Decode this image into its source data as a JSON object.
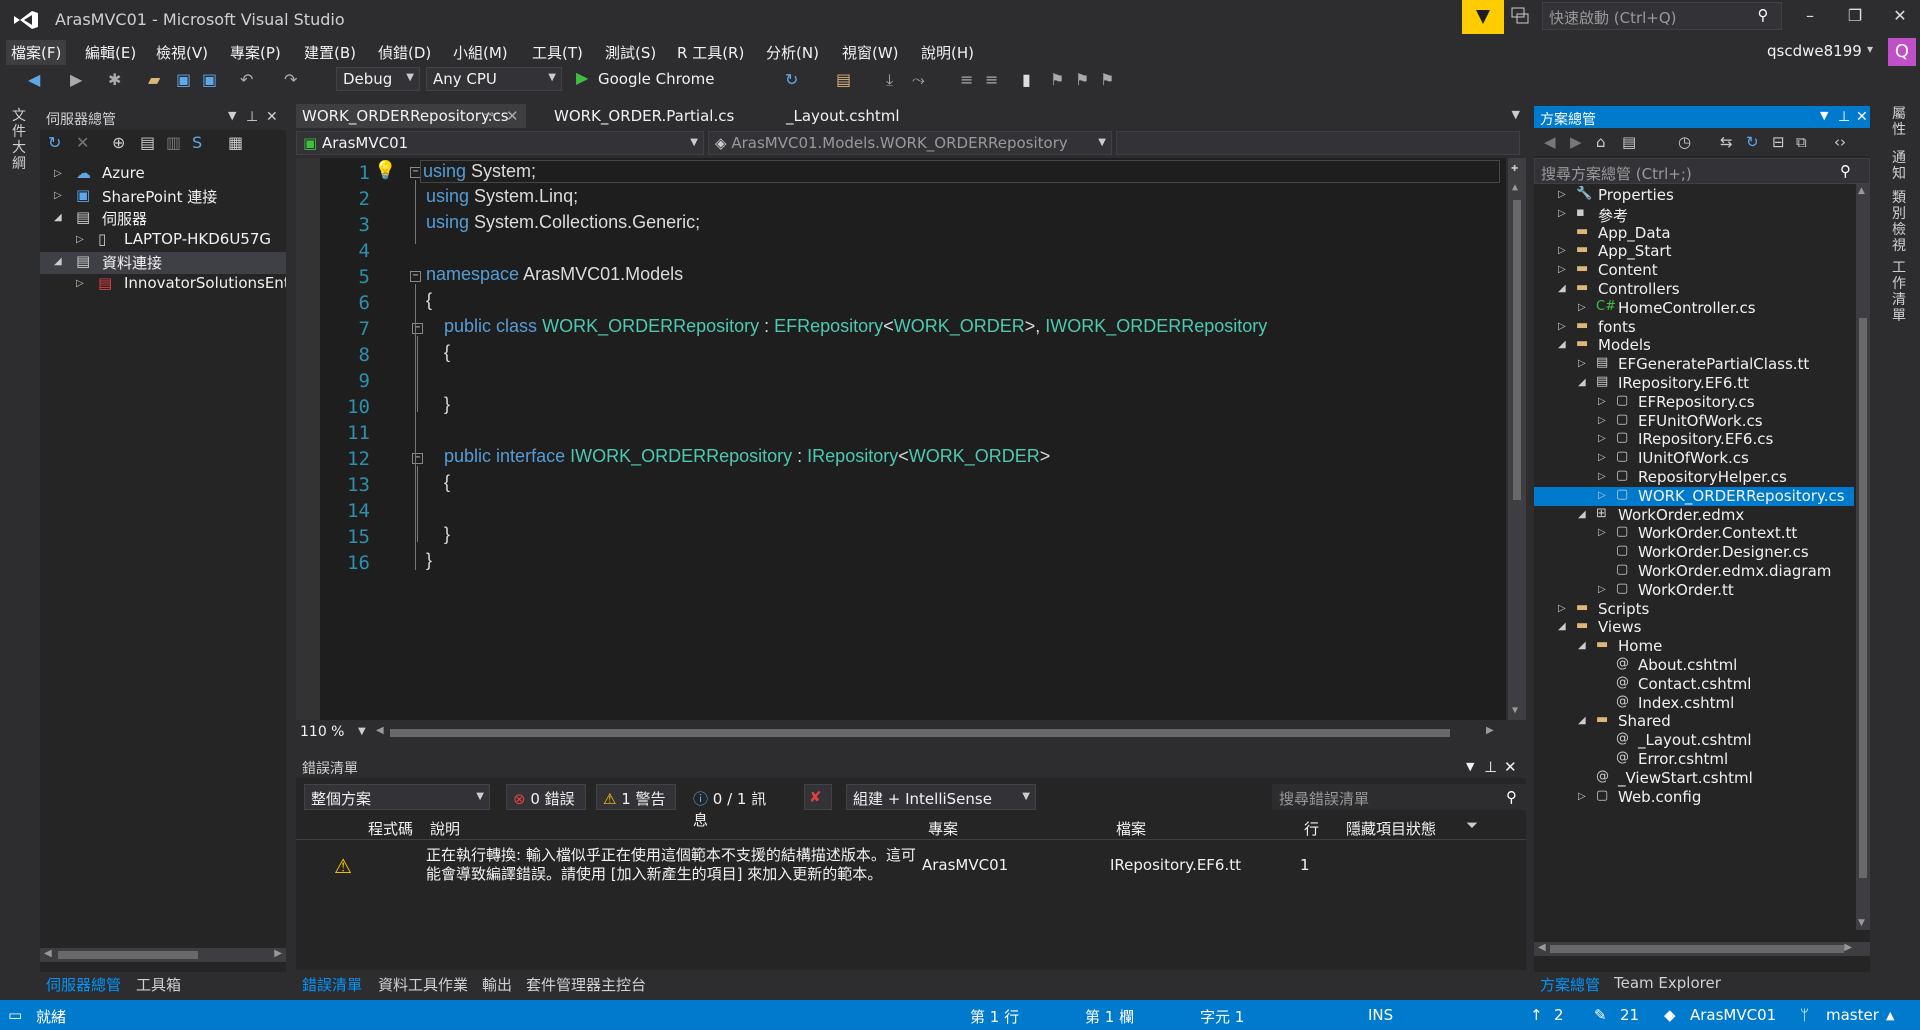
{
  "window": {
    "title": "ArasMVC01 - Microsoft Visual Studio",
    "quick_launch_placeholder": "快速啟動 (Ctrl+Q)",
    "user": "qscdwe8199",
    "avatar_letter": "Q"
  },
  "menu": [
    "檔案(F)",
    "編輯(E)",
    "檢視(V)",
    "專案(P)",
    "建置(B)",
    "偵錯(D)",
    "小組(M)",
    "工具(T)",
    "測試(S)",
    "R 工具(R)",
    "分析(N)",
    "視窗(W)",
    "說明(H)"
  ],
  "toolbar": {
    "config": "Debug",
    "platform": "Any CPU",
    "run_target": "Google Chrome"
  },
  "left_strip_label": "文件大綱",
  "server_explorer": {
    "title": "伺服器總管",
    "items": [
      {
        "label": "Azure",
        "expanded": false
      },
      {
        "label": "SharePoint 連接",
        "expanded": false
      },
      {
        "label": "伺服器",
        "expanded": true
      },
      {
        "label": "LAPTOP-HKD6U57G",
        "expanded": false
      },
      {
        "label": "資料連接",
        "expanded": true
      },
      {
        "label": "InnovatorSolutionsEntit",
        "expanded": false
      }
    ],
    "bottom_tabs": [
      "伺服器總管",
      "工具箱"
    ]
  },
  "editor": {
    "tabs": [
      "WORK_ORDERRepository.cs",
      "WORK_ORDER.Partial.cs",
      "_Layout.cshtml"
    ],
    "nav_project": "ArasMVC01",
    "nav_scope": "ArasMVC01.Models.WORK_ORDERRepository",
    "line_numbers": [
      "1",
      "2",
      "3",
      "4",
      "5",
      "6",
      "7",
      "8",
      "9",
      "10",
      "11",
      "12",
      "13",
      "14",
      "15",
      "16"
    ],
    "code": {
      "l1_kw": "using",
      "l1_rest": " System;",
      "l2_kw": "using",
      "l2_rest": " System.Linq;",
      "l3_kw": "using",
      "l3_rest": " System.Collections.Generic;",
      "l5_kw": "namespace",
      "l5_rest": " ArasMVC01.Models",
      "l6": "{",
      "l7_kw1": "public",
      "l7_kw2": "class",
      "l7_t1": "WORK_ORDERRepository",
      "l7_p1": " : ",
      "l7_t2": "EFRepository",
      "l7_p2": "<",
      "l7_t3": "WORK_ORDER",
      "l7_p3": ">, ",
      "l7_t4": "IWORK_ORDERRepository",
      "l8": "{",
      "l10": "}",
      "l12_kw1": "public",
      "l12_kw2": "interface",
      "l12_t1": "IWORK_ORDERRepository",
      "l12_p1": " : ",
      "l12_t2": "IRepository",
      "l12_p2": "<",
      "l12_t3": "WORK_ORDER",
      "l12_p3": ">",
      "l13": "{",
      "l15": "}",
      "l16": "}"
    },
    "zoom": "110 %"
  },
  "error_list": {
    "title": "錯誤清單",
    "scope": "整個方案",
    "errors": "0 錯誤",
    "warnings": "1 警告",
    "messages": "0 / 1 訊息",
    "build_filter": "組建 + IntelliSense",
    "search_placeholder": "搜尋錯誤清單",
    "columns": [
      "程式碼",
      "說明",
      "專案",
      "檔案",
      "行",
      "隱藏項目狀態"
    ],
    "row": {
      "desc_line1": "正在執行轉換: 輸入檔似乎正在使用這個範本不支援的結構描述版本。這可",
      "desc_line2": "能會導致編譯錯誤。請使用 [加入新產生的項目] 來加入更新的範本。",
      "project": "ArasMVC01",
      "file": "IRepository.EF6.tt",
      "line": "1"
    },
    "bottom_tabs": [
      "錯誤清單",
      "資料工具作業",
      "輸出",
      "套件管理器主控台"
    ]
  },
  "solution_explorer": {
    "title": "方案總管",
    "search_placeholder": "搜尋方案總管 (Ctrl+;)",
    "items": [
      "Properties",
      "參考",
      "App_Data",
      "App_Start",
      "Content",
      "Controllers",
      "HomeController.cs",
      "fonts",
      "Models",
      "EFGeneratePartialClass.tt",
      "IRepository.EF6.tt",
      "EFRepository.cs",
      "EFUnitOfWork.cs",
      "IRepository.EF6.cs",
      "IUnitOfWork.cs",
      "RepositoryHelper.cs",
      "WORK_ORDERRepository.cs",
      "WorkOrder.edmx",
      "WorkOrder.Context.tt",
      "WorkOrder.Designer.cs",
      "WorkOrder.edmx.diagram",
      "WorkOrder.tt",
      "Scripts",
      "Views",
      "Home",
      "About.cshtml",
      "Contact.cshtml",
      "Index.cshtml",
      "Shared",
      "_Layout.cshtml",
      "Error.cshtml",
      "_ViewStart.cshtml",
      "Web.config"
    ],
    "bottom_tabs": [
      "方案總管",
      "Team Explorer"
    ]
  },
  "right_strip_labels": [
    "屬性",
    "通知",
    "類別檢視",
    "工作清單"
  ],
  "status": {
    "ready": "就緒",
    "line": "第 1 行",
    "col": "第 1 欄",
    "char": "字元 1",
    "ins": "INS",
    "up": "2",
    "edits": "21",
    "repo": "ArasMVC01",
    "branch": "master"
  }
}
